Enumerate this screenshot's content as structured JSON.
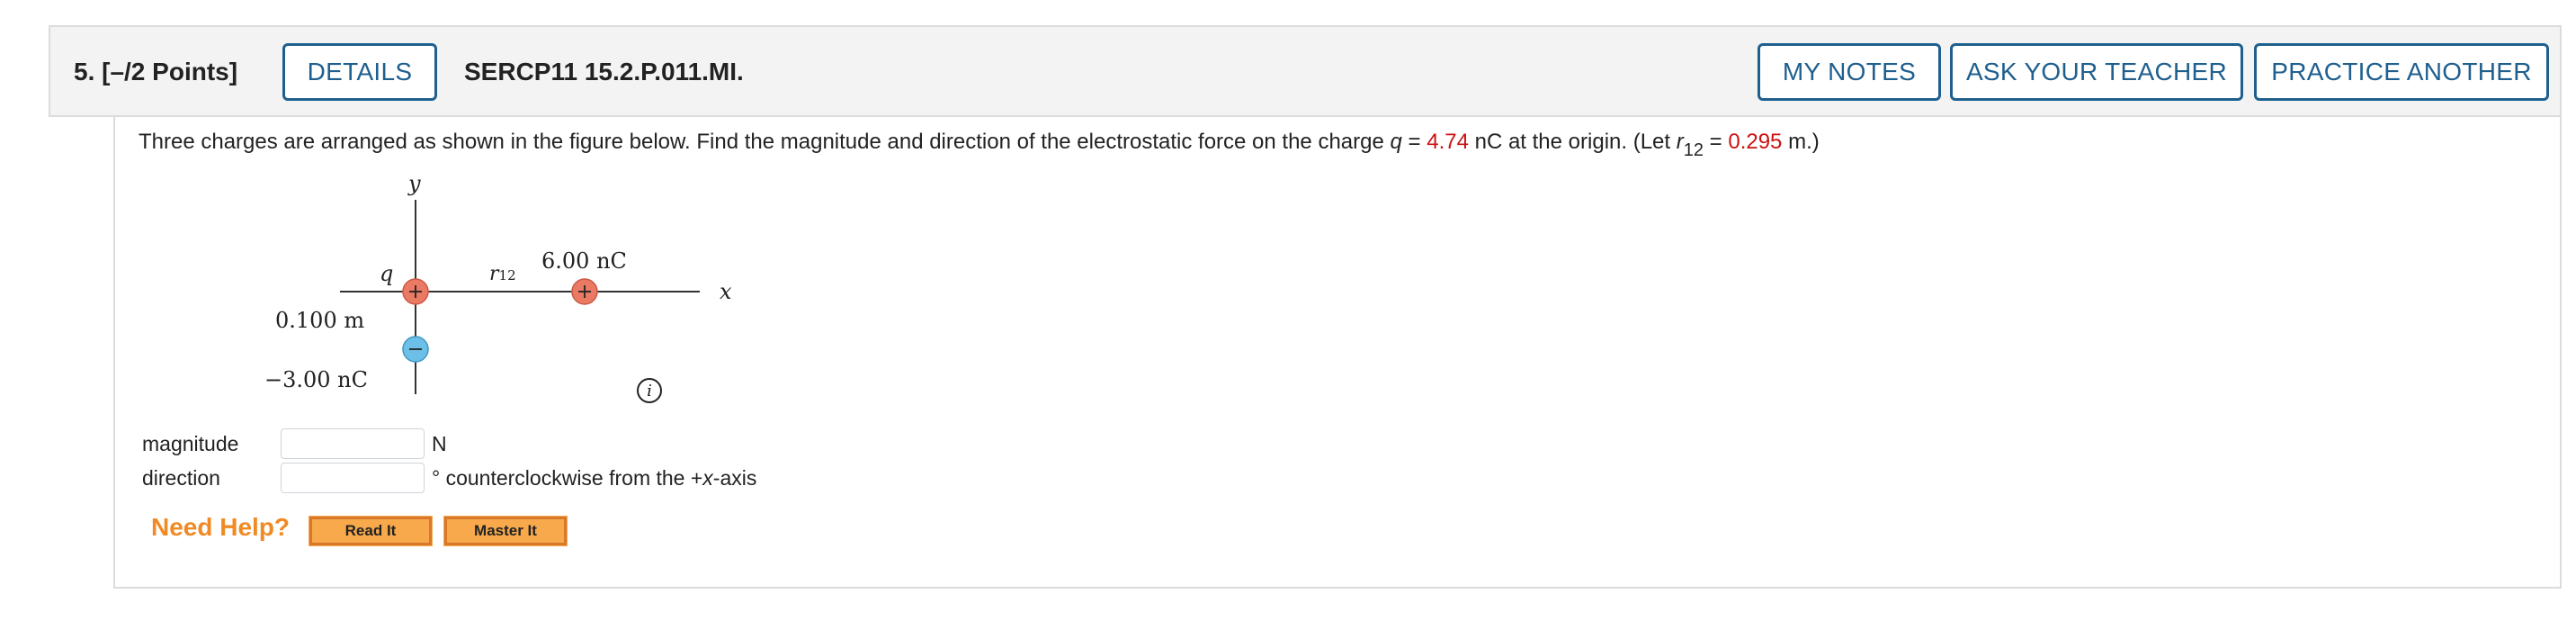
{
  "question": {
    "number_label": "5.  [–/2 Points]",
    "code": "SERCP11 15.2.P.011.MI."
  },
  "buttons": {
    "details": "DETAILS",
    "my_notes": "MY NOTES",
    "ask_teacher": "ASK YOUR TEACHER",
    "practice_another": "PRACTICE ANOTHER"
  },
  "prompt": {
    "part1": "Three charges are arranged as shown in the figure below. Find the magnitude and direction of the electrostatic force on the charge ",
    "q_var": "q",
    "eq1": " = ",
    "q_value": "4.74",
    "part2": " nC at the origin. (Let ",
    "r_var": "r",
    "r_sub": "12",
    "eq2": " = ",
    "r_value": "0.295",
    "part3": " m.)"
  },
  "figure": {
    "y_axis": "y",
    "x_axis": "x",
    "q_label": "q",
    "r12_label": "r",
    "r12_sub": "12",
    "charge_right": "6.00 nC",
    "distance": "0.100 m",
    "charge_bottom": "−3.00 nC",
    "info_symbol": "i"
  },
  "answers": {
    "magnitude_label": "magnitude",
    "magnitude_value": "",
    "magnitude_unit": "N",
    "direction_label": "direction",
    "direction_value": "",
    "direction_unit_pre": "° counterclockwise from the +",
    "direction_unit_var": "x",
    "direction_unit_post": "-axis"
  },
  "help": {
    "label": "Need Help?",
    "read_it": "Read It",
    "master_it": "Master It"
  },
  "colors": {
    "accent": "#1f5f8e",
    "given_value": "#cc1111",
    "help_orange": "#f08a24",
    "positive_charge": "#ea7a63",
    "negative_charge": "#6cc0e8"
  }
}
